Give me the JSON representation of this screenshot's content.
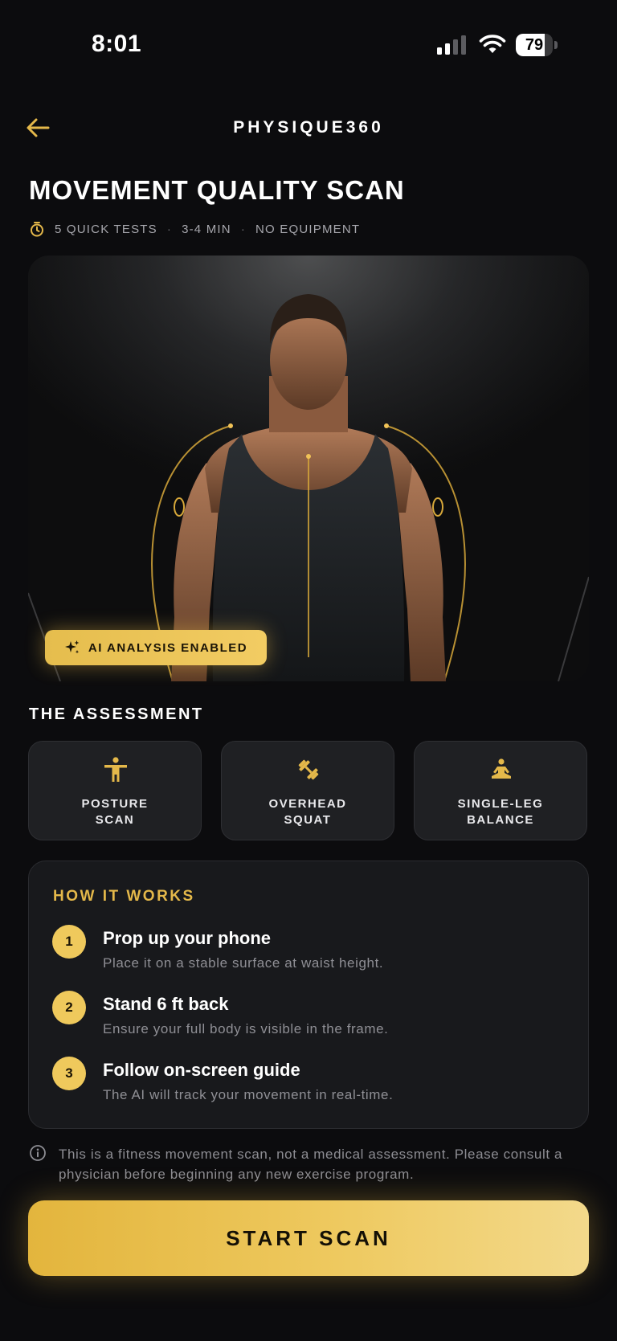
{
  "status_bar": {
    "time": "8:01",
    "battery": "79",
    "battery_level": 0.79,
    "icons": [
      "cellular-signal-icon",
      "wifi-icon",
      "battery-icon"
    ]
  },
  "header": {
    "back_icon": "arrow-left-icon",
    "app_title": "PHYSIQUE360"
  },
  "scan": {
    "title": "MOVEMENT QUALITY SCAN",
    "meta_icon": "stopwatch-icon",
    "meta": [
      "5 QUICK TESTS",
      "3-4 MIN",
      "NO EQUIPMENT"
    ],
    "meta_separator": "·"
  },
  "hero": {
    "image": "athlete-tank-top-portrait",
    "badge_icon": "sparkles-icon",
    "badge_label": "AI ANALYSIS ENABLED"
  },
  "assessment": {
    "title": "THE ASSESSMENT",
    "tests": [
      {
        "label": "POSTURE\nSCAN",
        "icon": "standing-person-icon"
      },
      {
        "label": "OVERHEAD\nSQUAT",
        "icon": "dumbbell-icon"
      },
      {
        "label": "SINGLE-LEG\nBALANCE",
        "icon": "meditation-pose-icon"
      }
    ]
  },
  "how_it_works": {
    "title": "HOW IT WORKS",
    "steps": [
      {
        "number": "1",
        "title": "Prop up your phone",
        "desc": "Place it on a stable surface at waist height."
      },
      {
        "number": "2",
        "title": "Stand 6 ft back",
        "desc": "Ensure your full body is visible in the frame."
      },
      {
        "number": "3",
        "title": "Follow on-screen guide",
        "desc": "The AI will track your movement in real-time."
      }
    ]
  },
  "disclaimer": {
    "icon": "info-circle-icon",
    "text": "This is a fitness movement scan, not a medical assessment. Please consult a physician before beginning any new exercise program."
  },
  "cta": {
    "label": "START SCAN"
  },
  "colors": {
    "background": "#0c0c0e",
    "accent_gold": "#e8bf4f",
    "card": "#1f2023"
  }
}
